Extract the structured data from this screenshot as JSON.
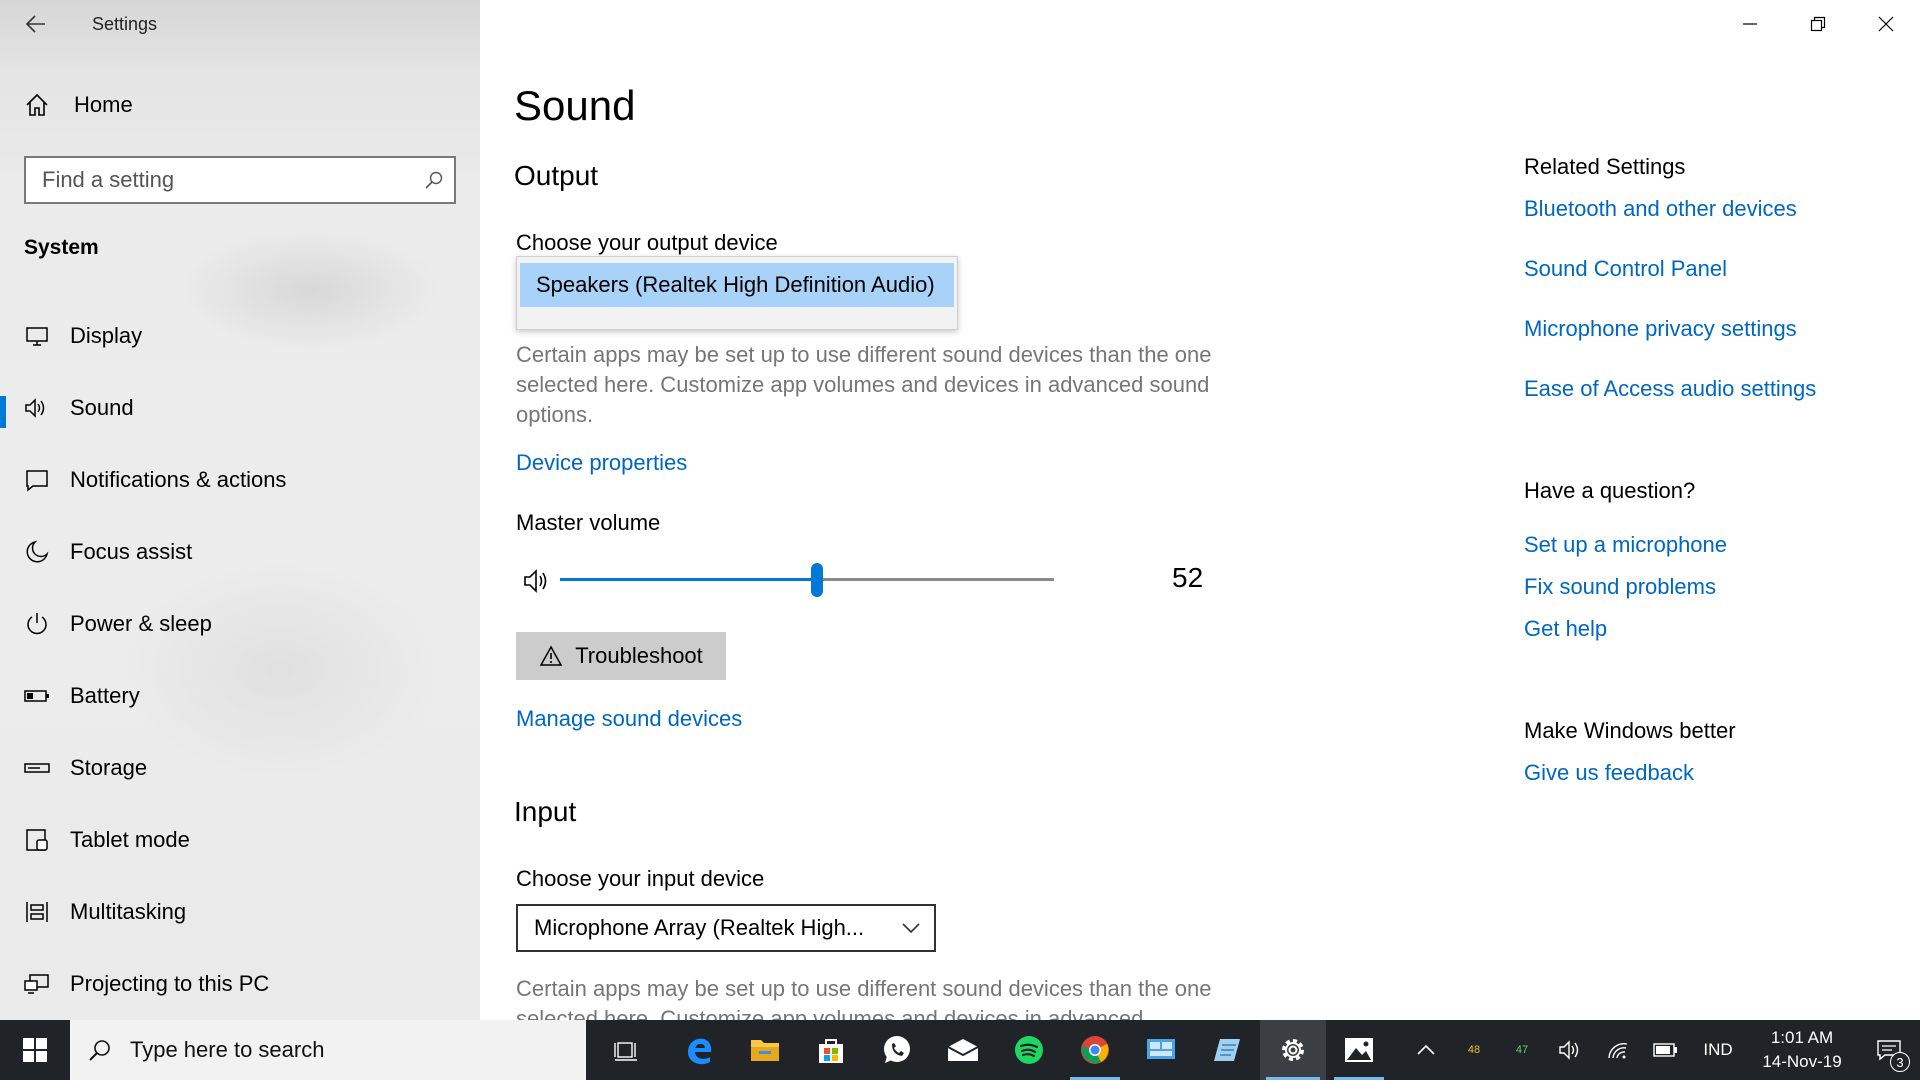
{
  "window": {
    "app_title": "Settings"
  },
  "sidebar": {
    "home_label": "Home",
    "search_placeholder": "Find a setting",
    "section_label": "System",
    "items": [
      {
        "label": "Display",
        "icon": "display-icon"
      },
      {
        "label": "Sound",
        "icon": "speaker-icon",
        "active": true
      },
      {
        "label": "Notifications & actions",
        "icon": "notification-icon"
      },
      {
        "label": "Focus assist",
        "icon": "moon-icon"
      },
      {
        "label": "Power & sleep",
        "icon": "power-icon"
      },
      {
        "label": "Battery",
        "icon": "battery-icon"
      },
      {
        "label": "Storage",
        "icon": "storage-icon"
      },
      {
        "label": "Tablet mode",
        "icon": "tablet-icon"
      },
      {
        "label": "Multitasking",
        "icon": "multitasking-icon"
      },
      {
        "label": "Projecting to this PC",
        "icon": "projecting-icon"
      }
    ]
  },
  "main": {
    "title": "Sound",
    "output": {
      "heading": "Output",
      "device_label": "Choose your output device",
      "device_option": "Speakers (Realtek High Definition Audio)",
      "description": "Certain apps may be set up to use different sound devices than the one selected here. Customize app volumes and devices in advanced sound options.",
      "device_properties_link": "Device properties",
      "master_volume_label": "Master volume",
      "master_volume_value": 52,
      "troubleshoot_label": "Troubleshoot",
      "manage_devices_link": "Manage sound devices"
    },
    "input": {
      "heading": "Input",
      "device_label": "Choose your input device",
      "device_value": "Microphone Array (Realtek High...",
      "description": "Certain apps may be set up to use different sound devices than the one selected here. Customize app volumes and devices in advanced"
    }
  },
  "related": {
    "heading": "Related Settings",
    "links": [
      "Bluetooth and other devices",
      "Sound Control Panel",
      "Microphone privacy settings",
      "Ease of Access audio settings"
    ],
    "question_heading": "Have a question?",
    "question_links": [
      "Set up a microphone",
      "Fix sound problems",
      "Get help"
    ],
    "better_heading": "Make Windows better",
    "better_links": [
      "Give us feedback"
    ]
  },
  "taskbar": {
    "search_placeholder": "Type here to search",
    "tray_badge_1": "48",
    "tray_badge_2": "47",
    "language": "IND",
    "time": "1:01 AM",
    "date": "14-Nov-19",
    "notification_count": "3"
  },
  "colors": {
    "accent": "#0078d7",
    "link": "#0067c0",
    "taskbar": "#202428"
  }
}
